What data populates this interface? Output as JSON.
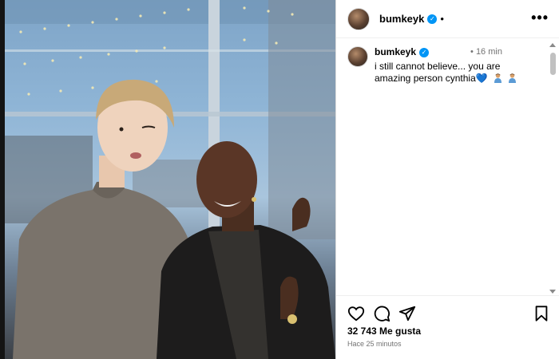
{
  "post": {
    "username": "bumkeyk",
    "verified_mark": "✓",
    "separator": "•",
    "more_label": "•••"
  },
  "comment": {
    "username": "bumkeyk",
    "verified_mark": "✓",
    "time": "• 16 min",
    "text": "i still cannot believe... you are amazing person cynthia",
    "heart": "💙"
  },
  "actions": {
    "icons": [
      "heart-icon",
      "comment-icon",
      "share-icon",
      "bookmark-icon"
    ]
  },
  "likes_label": "32 743 Me gusta",
  "timestamp_label": "Hace 25 minutos",
  "colors": {
    "verified_blue": "#0095f6",
    "secondary_text": "#737373",
    "border": "#dbdbdb"
  }
}
